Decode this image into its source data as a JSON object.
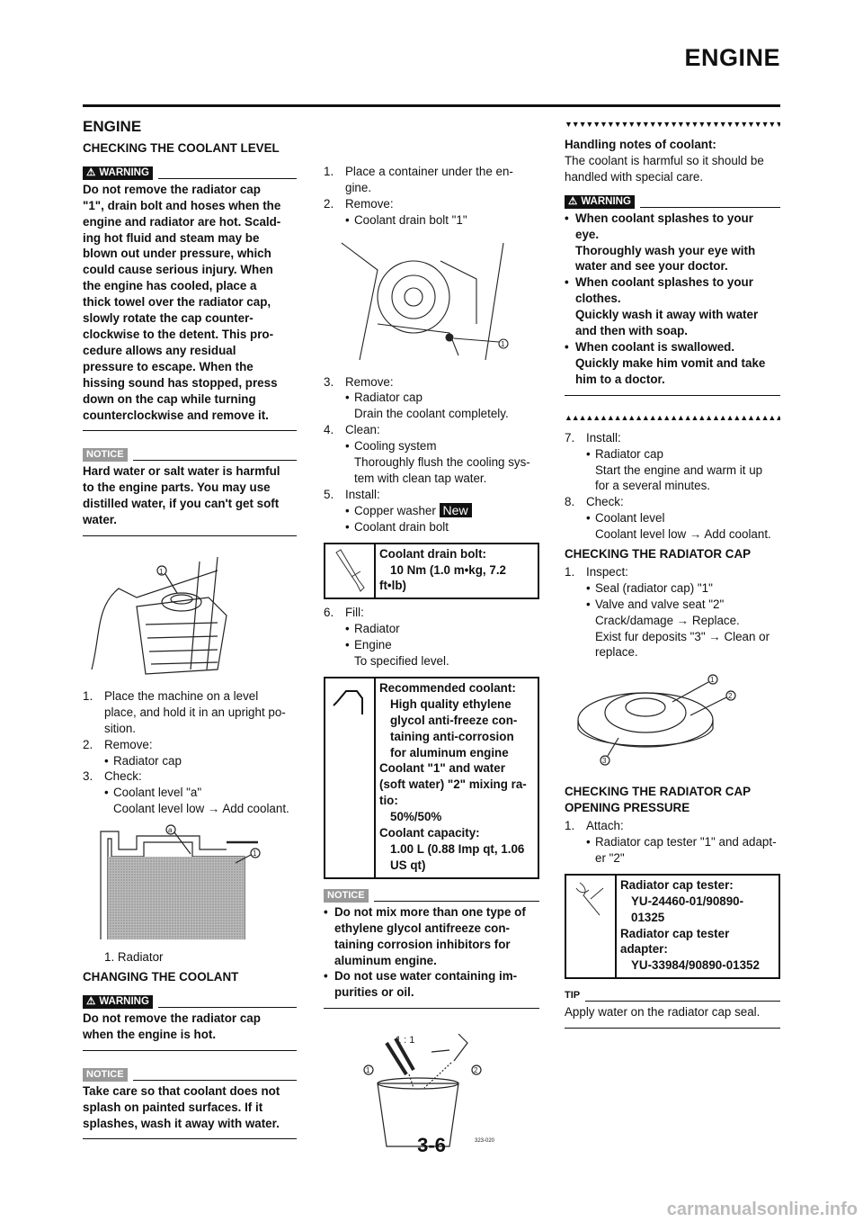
{
  "header": {
    "title": "ENGINE"
  },
  "footer": {
    "page": "3-6"
  },
  "watermark": "carmanualsonline.info",
  "badges": {
    "warning": "WARNING",
    "notice": "NOTICE",
    "tip": "TIP",
    "new": "New"
  },
  "columns": [
    [
      {
        "type": "h1",
        "text": "ENGINE"
      },
      {
        "type": "h2",
        "text": "CHECKING THE COOLANT LEVEL"
      },
      {
        "type": "badge",
        "kind": "warning"
      },
      {
        "type": "bold",
        "text": "Do not remove the radiator cap\n\"1\", drain bolt and hoses when the\nengine and radiator are hot. Scald-\ning hot fluid and steam may be\nblown out under pressure, which\ncould cause serious injury. When\nthe engine has cooled, place a\nthick towel over the radiator cap,\nslowly rotate the cap counter-\nclockwise to the detent. This pro-\ncedure allows any residual\npressure to escape. When the\nhissing sound has stopped, press\ndown on the cap while turning\ncounterclockwise and remove it."
      },
      {
        "type": "rule"
      },
      {
        "type": "badge",
        "kind": "notice"
      },
      {
        "type": "bold",
        "text": "Hard water or salt water is harmful\nto the engine parts. You may use\ndistilled water, if you can't get soft\nwater."
      },
      {
        "type": "rule"
      },
      {
        "type": "figure",
        "kind": "radiator",
        "labels": [
          "1"
        ]
      },
      {
        "type": "step",
        "num": "1.",
        "text": "Place the machine on a level\nplace, and hold it in an upright po-\nsition."
      },
      {
        "type": "step",
        "num": "2.",
        "text": "Remove:"
      },
      {
        "type": "bullet",
        "text": "Radiator cap"
      },
      {
        "type": "step",
        "num": "3.",
        "text": "Check:"
      },
      {
        "type": "bullet",
        "text": "Coolant level \"a\""
      },
      {
        "type": "sub",
        "text": "Coolant level low → Add coolant."
      },
      {
        "type": "figure",
        "kind": "level",
        "labels": [
          "a",
          "1"
        ]
      },
      {
        "type": "caption",
        "text": "1.    Radiator"
      },
      {
        "type": "h2",
        "text": "CHANGING THE COOLANT"
      },
      {
        "type": "badge",
        "kind": "warning"
      },
      {
        "type": "bold",
        "text": "Do not remove the radiator cap\nwhen the engine is hot."
      },
      {
        "type": "rule"
      },
      {
        "type": "badge",
        "kind": "notice"
      },
      {
        "type": "bold",
        "text": "Take care so that coolant does not\nsplash on painted surfaces. If it\nsplashes, wash it away with water."
      },
      {
        "type": "rule"
      }
    ],
    [
      {
        "type": "step",
        "num": "1.",
        "text": "Place a container under the en-\ngine."
      },
      {
        "type": "step",
        "num": "2.",
        "text": "Remove:"
      },
      {
        "type": "bullet",
        "text": "Coolant drain bolt \"1\""
      },
      {
        "type": "figure",
        "kind": "engine",
        "labels": [
          "1"
        ]
      },
      {
        "type": "step",
        "num": "3.",
        "text": "Remove:"
      },
      {
        "type": "bullet",
        "text": "Radiator cap"
      },
      {
        "type": "sub",
        "text": "Drain the coolant completely."
      },
      {
        "type": "step",
        "num": "4.",
        "text": "Clean:"
      },
      {
        "type": "bullet",
        "text": "Cooling system"
      },
      {
        "type": "sub",
        "text": "Thoroughly flush the cooling sys-\ntem with clean tap water."
      },
      {
        "type": "step",
        "num": "5.",
        "text": "Install:"
      },
      {
        "type": "bullet",
        "text": "Copper washer",
        "new": true
      },
      {
        "type": "bullet",
        "text": "Coolant drain bolt"
      },
      {
        "type": "spec",
        "icon": "torque-wrench",
        "lines": [
          {
            "text": "Coolant drain bolt:",
            "indent": false
          },
          {
            "text": "10 Nm (1.0 m•kg, 7.2",
            "indent": true
          },
          {
            "text": "ft•lb)",
            "indent": false
          }
        ]
      },
      {
        "type": "step",
        "num": "6.",
        "text": "Fill:"
      },
      {
        "type": "bullet",
        "text": "Radiator"
      },
      {
        "type": "bullet",
        "text": "Engine"
      },
      {
        "type": "sub",
        "text": "To specified level."
      },
      {
        "type": "spec",
        "icon": "oil-can",
        "lines": [
          {
            "text": "Recommended coolant:",
            "indent": false
          },
          {
            "text": "High quality ethylene\nglycol anti-freeze con-\ntaining anti-corrosion\nfor aluminum engine",
            "indent": true
          },
          {
            "text": "Coolant \"1\" and water\n(soft water) \"2\" mixing ra-\ntio:",
            "indent": false
          },
          {
            "text": "50%/50%",
            "indent": true
          },
          {
            "text": "Coolant capacity:",
            "indent": false
          },
          {
            "text": "1.00 L (0.88 Imp qt, 1.06\nUS qt)",
            "indent": true
          }
        ]
      },
      {
        "type": "badge",
        "kind": "notice"
      },
      {
        "type": "topbullet",
        "text": "Do not mix more than one type of\nethylene glycol antifreeze con-\ntaining corrosion inhibitors for\naluminum engine."
      },
      {
        "type": "topbullet",
        "text": "Do not use water containing im-\npurities or oil."
      },
      {
        "type": "rule"
      },
      {
        "type": "figure",
        "kind": "bucket",
        "labels": [
          "1 : 1",
          "1",
          "2",
          "323-020"
        ]
      }
    ],
    [
      {
        "type": "tri",
        "dir": "down"
      },
      {
        "type": "bold",
        "text": "Handling notes of coolant:"
      },
      {
        "type": "para",
        "text": "The coolant is harmful so it should be\nhandled with special care."
      },
      {
        "type": "badge",
        "kind": "warning"
      },
      {
        "type": "topbullet",
        "bold": true,
        "text": "When coolant splashes to your\neye.\nThoroughly wash your eye with\nwater and see your doctor."
      },
      {
        "type": "topbullet",
        "bold": true,
        "text": "When coolant splashes to your\nclothes.\nQuickly wash it away with water\nand then with soap."
      },
      {
        "type": "topbullet",
        "bold": true,
        "text": "When coolant is swallowed.\nQuickly make him vomit and take\nhim to a doctor."
      },
      {
        "type": "rule"
      },
      {
        "type": "tri",
        "dir": "up"
      },
      {
        "type": "step",
        "num": "7.",
        "text": "Install:"
      },
      {
        "type": "bullet",
        "text": "Radiator cap"
      },
      {
        "type": "sub",
        "text": "Start the engine and warm it up\nfor a several minutes."
      },
      {
        "type": "step",
        "num": "8.",
        "text": "Check:"
      },
      {
        "type": "bullet",
        "text": "Coolant level"
      },
      {
        "type": "sub",
        "text": "Coolant level low → Add coolant."
      },
      {
        "type": "h2",
        "text": "CHECKING THE RADIATOR CAP"
      },
      {
        "type": "step",
        "num": "1.",
        "text": "Inspect:"
      },
      {
        "type": "bullet",
        "text": "Seal (radiator cap) \"1\""
      },
      {
        "type": "bullet",
        "text": "Valve and valve seat \"2\""
      },
      {
        "type": "sub",
        "text": "Crack/damage → Replace.\nExist fur deposits \"3\" → Clean or\nreplace."
      },
      {
        "type": "figure",
        "kind": "cap",
        "labels": [
          "1",
          "2",
          "3"
        ]
      },
      {
        "type": "h2",
        "text": "CHECKING THE RADIATOR CAP\nOPENING PRESSURE"
      },
      {
        "type": "step",
        "num": "1.",
        "text": "Attach:"
      },
      {
        "type": "bullet",
        "text": "Radiator cap tester \"1\" and adapt-\ner \"2\""
      },
      {
        "type": "spec",
        "icon": "special-tool",
        "lines": [
          {
            "text": "Radiator cap tester:",
            "indent": false
          },
          {
            "text": "YU-24460-01/90890-\n01325",
            "indent": true
          },
          {
            "text": "Radiator cap tester\nadapter:",
            "indent": false
          },
          {
            "text": "YU-33984/90890-01352",
            "indent": true
          }
        ]
      },
      {
        "type": "badge",
        "kind": "tip"
      },
      {
        "type": "para",
        "text": "Apply water on the radiator cap seal."
      },
      {
        "type": "rule"
      }
    ]
  ]
}
